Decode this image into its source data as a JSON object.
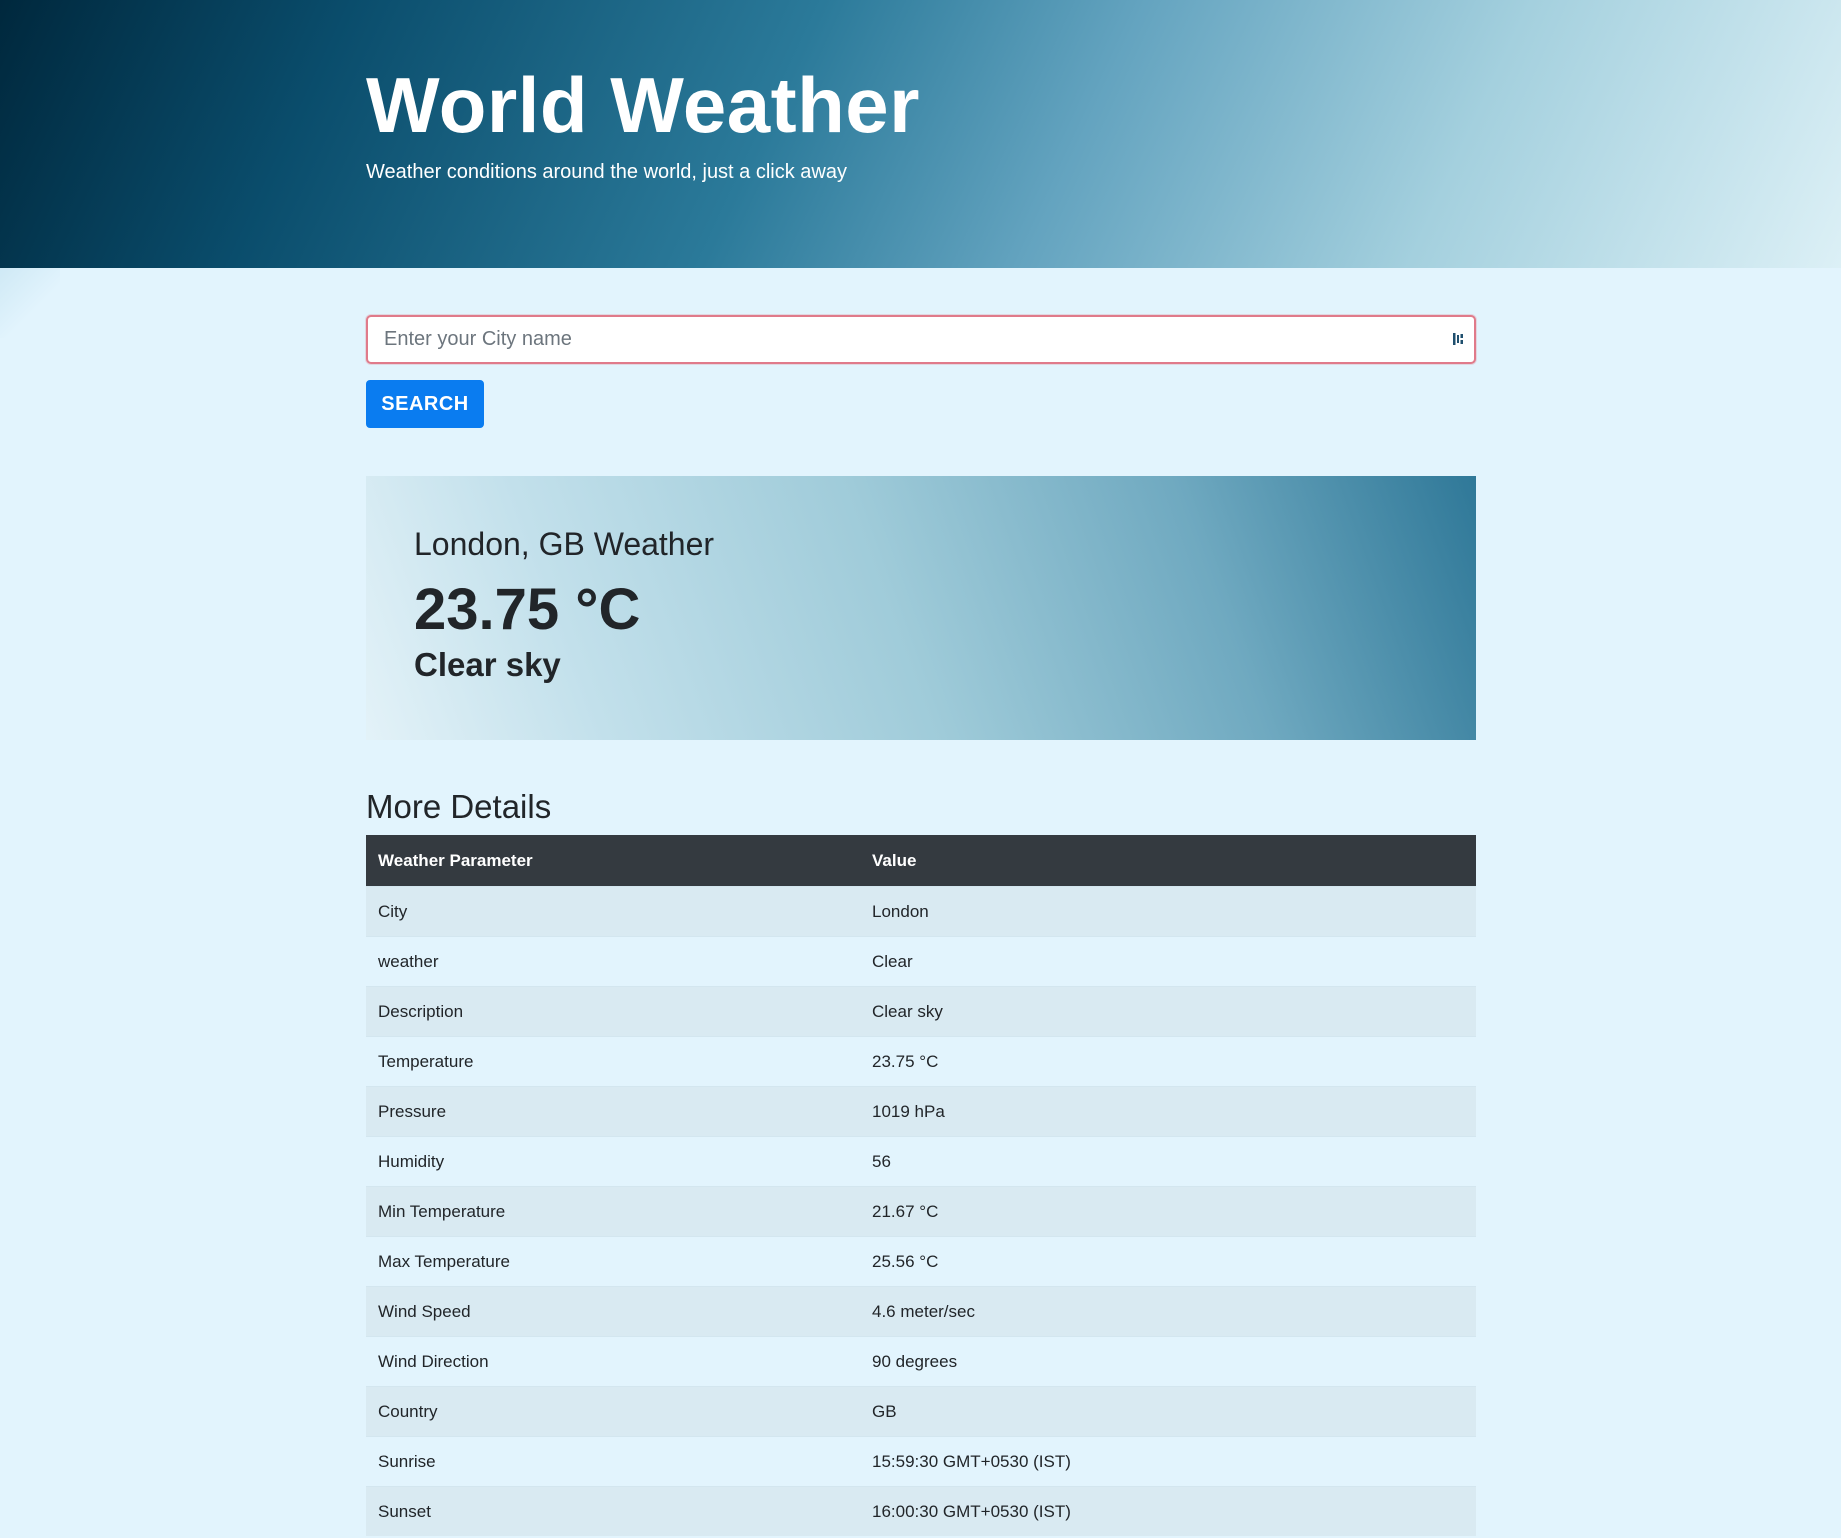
{
  "header": {
    "title": "World Weather",
    "subtitle": "Weather conditions around the world, just a click away"
  },
  "search": {
    "placeholder": "Enter your City name",
    "value": "",
    "button_label": "SEARCH",
    "icon": "password-manager-icon"
  },
  "summary": {
    "city_label": "London, GB Weather",
    "temperature": "23.75 °C",
    "description": "Clear sky"
  },
  "details": {
    "title": "More Details",
    "columns": [
      "Weather Parameter",
      "Value"
    ],
    "rows": [
      {
        "param": "City",
        "value": "London"
      },
      {
        "param": "weather",
        "value": "Clear"
      },
      {
        "param": "Description",
        "value": "Clear sky"
      },
      {
        "param": "Temperature",
        "value": "23.75 °C"
      },
      {
        "param": "Pressure",
        "value": "1019 hPa"
      },
      {
        "param": "Humidity",
        "value": "56"
      },
      {
        "param": "Min Temperature",
        "value": "21.67 °C"
      },
      {
        "param": "Max Temperature",
        "value": "25.56 °C"
      },
      {
        "param": "Wind Speed",
        "value": "4.6 meter/sec"
      },
      {
        "param": "Wind Direction",
        "value": "90 degrees"
      },
      {
        "param": "Country",
        "value": "GB"
      },
      {
        "param": "Sunrise",
        "value": "15:59:30 GMT+0530 (IST)"
      },
      {
        "param": "Sunset",
        "value": "16:00:30 GMT+0530 (IST)"
      }
    ]
  },
  "colors": {
    "primary_button": "#0a7cf0",
    "table_header": "#343a40",
    "page_background": "#e2f4fd"
  }
}
